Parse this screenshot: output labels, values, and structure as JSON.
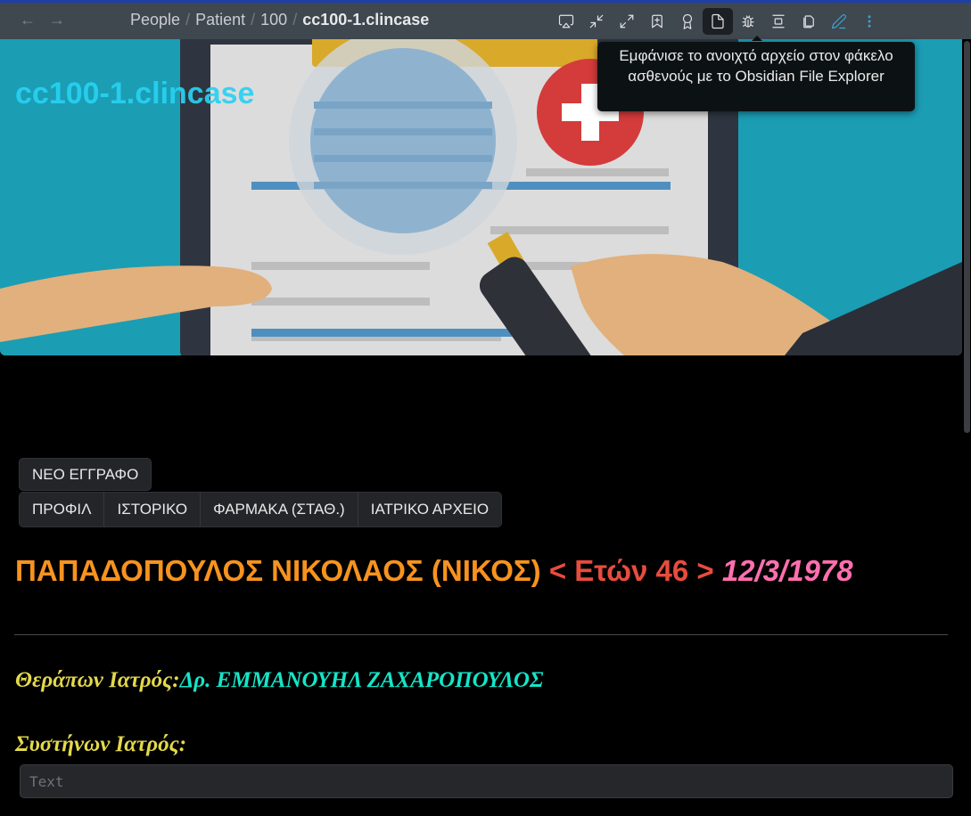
{
  "topbar": {
    "back_icon": "arrow-left-icon",
    "forward_icon": "arrow-right-icon",
    "breadcrumb": [
      "People",
      "Patient",
      "100"
    ],
    "current_file": "cc100-1.clincase",
    "separator": "/",
    "actions": [
      {
        "name": "cast-icon"
      },
      {
        "name": "collapse-icon"
      },
      {
        "name": "expand-icon"
      },
      {
        "name": "bookmark-plus-icon"
      },
      {
        "name": "award-icon"
      },
      {
        "name": "file-icon",
        "active": true
      },
      {
        "name": "bug-icon"
      },
      {
        "name": "align-center-icon"
      },
      {
        "name": "copy-icon"
      },
      {
        "name": "pencil-icon"
      },
      {
        "name": "more-vertical-icon"
      }
    ]
  },
  "tooltip": {
    "text": "Εμφάνισε το ανοιχτό αρχείο στον φάκελο ασθενούς με το Obsidian File Explorer"
  },
  "banner": {
    "title": "cc100-1.clincase",
    "image": "medical-record-magnifier-illustration"
  },
  "buttons": {
    "new_document": "ΝΕΟ ΕΓΓΡΑΦΟ"
  },
  "tabs": [
    {
      "label": "ΠΡΟΦΙΛ"
    },
    {
      "label": "ΙΣΤΟΡΙΚΟ"
    },
    {
      "label": "ΦΑΡΜΑΚΑ (ΣΤΑΘ.)"
    },
    {
      "label": "ΙΑΤΡΙΚΟ ΑΡΧΕΙΟ"
    }
  ],
  "patient": {
    "name": "ΠΑΠΑΔΟΠΟΥΛΟΣ ΝΙΚΟΛΑΟΣ (ΝΙΚΟΣ)",
    "age": "< Ετών 46 >",
    "dob": "12/3/1978",
    "colors": {
      "name": "#f7931e",
      "age": "#e84c3d",
      "dob": "#ff6fb0"
    }
  },
  "attending": {
    "label": "Θεράπων Ιατρός:",
    "value": "Δρ. ΕΜΜΑΝΟΥΗΛ ΖΑΧΑΡΟΠΟΥΛΟΣ"
  },
  "referring": {
    "label": "Συστήνων Ιατρός:",
    "value": "",
    "placeholder": "Text"
  }
}
